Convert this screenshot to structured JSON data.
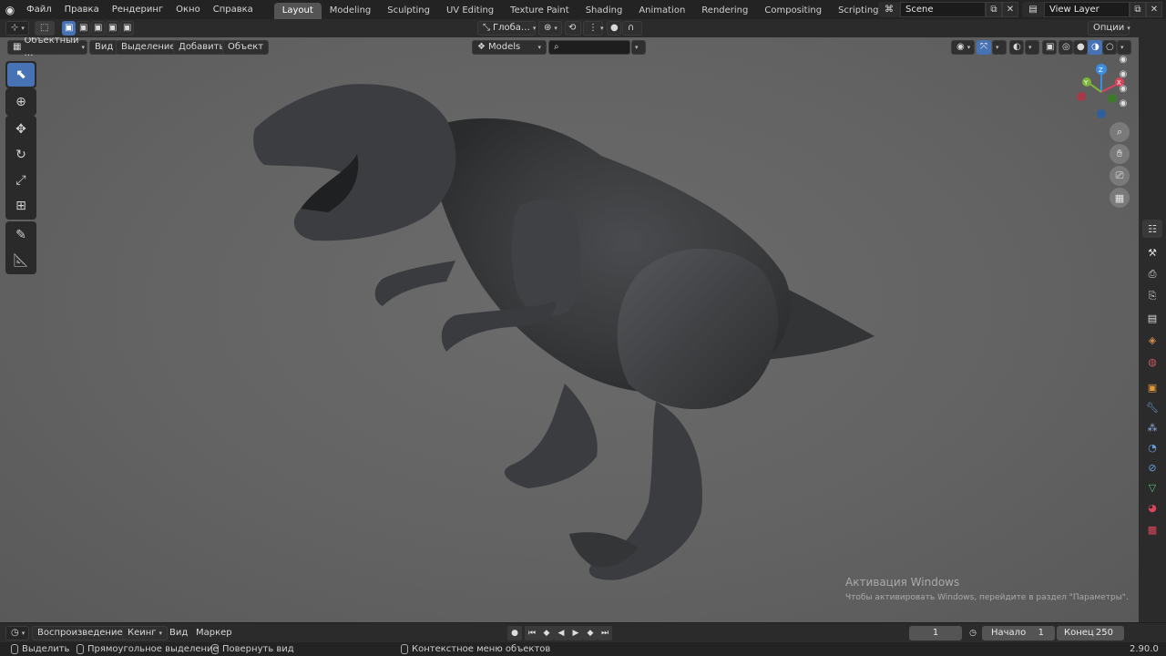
{
  "menu": {
    "items": [
      "Файл",
      "Правка",
      "Рендеринг",
      "Окно",
      "Справка"
    ]
  },
  "workspaces": {
    "tabs": [
      "Layout",
      "Modeling",
      "Sculpting",
      "UV Editing",
      "Texture Paint",
      "Shading",
      "Animation",
      "Rendering",
      "Compositing",
      "Scripting"
    ],
    "active": "Layout",
    "add": "+"
  },
  "scene": {
    "value": "Scene"
  },
  "view_layer": {
    "value": "View Layer"
  },
  "header": {
    "transform_orientation": "Глоба…",
    "options": "Опции"
  },
  "viewport_header": {
    "mode": "Объектный …",
    "view": "Вид",
    "select": "Выделение",
    "add": "Добавить",
    "object": "Объект",
    "collection": "Models",
    "search_placeholder": ""
  },
  "gizmo": {
    "x": "X",
    "y": "Y",
    "z": "Z"
  },
  "watermark": {
    "line1": "Активация Windows",
    "line2": "Чтобы активировать Windows, перейдите в раздел \"Параметры\"."
  },
  "timeline": {
    "playback": "Воспроизведение",
    "keying": "Кеинг",
    "view": "Вид",
    "marker": "Маркер",
    "current_frame": "1",
    "start_label": "Начало",
    "start_value": "1",
    "end_label": "Конец",
    "end_value": "250"
  },
  "status": {
    "select": "Выделить",
    "box_select": "Прямоугольное выделение",
    "rotate_view": "Повернуть вид",
    "context_menu": "Контекстное меню объектов",
    "version": "2.90.0"
  },
  "colors": {
    "accent": "#4772b3",
    "viewport": "#656565",
    "mesh": "#3a3b3d"
  }
}
